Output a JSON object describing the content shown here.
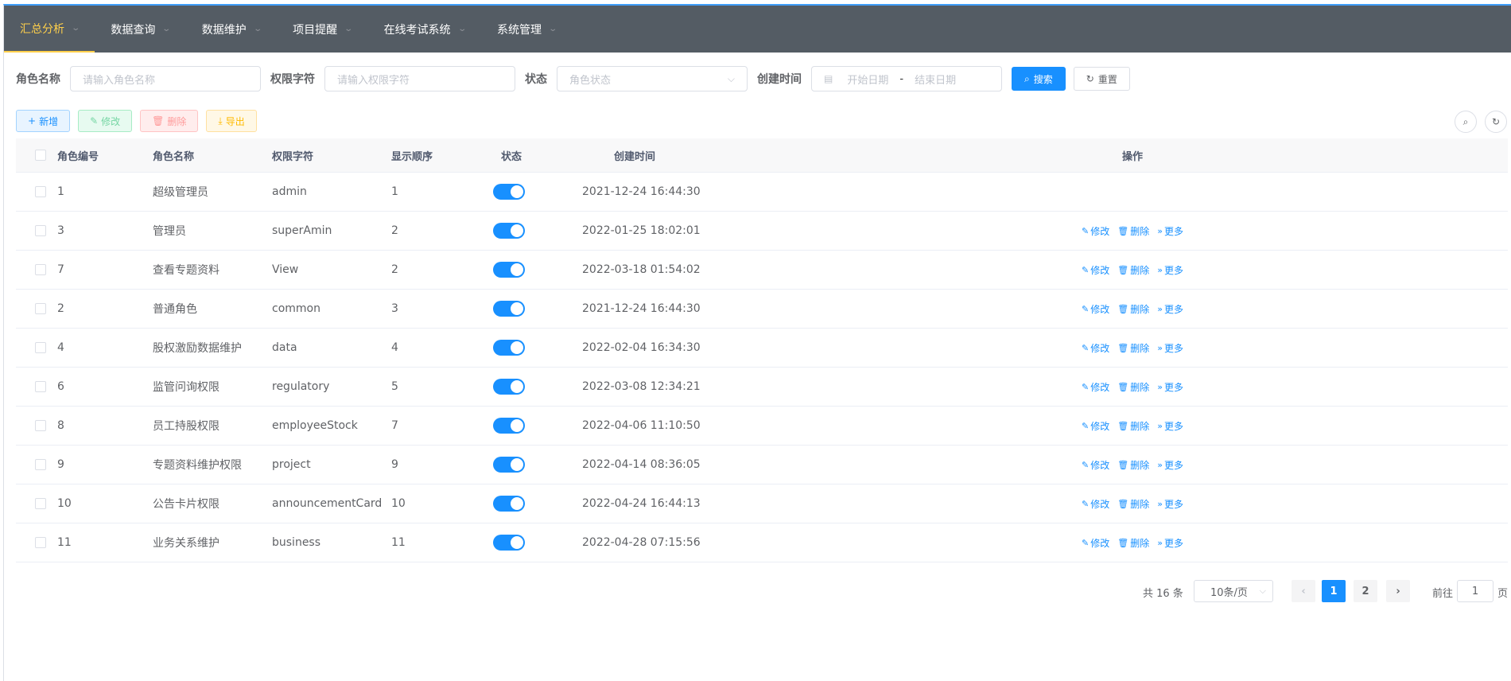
{
  "nav": {
    "items": [
      {
        "label": "汇总分析",
        "active": true
      },
      {
        "label": "数据查询"
      },
      {
        "label": "数据维护"
      },
      {
        "label": "项目提醒"
      },
      {
        "label": "在线考试系统"
      },
      {
        "label": "系统管理"
      }
    ]
  },
  "search": {
    "role_name_label": "角色名称",
    "role_name_placeholder": "请输入角色名称",
    "role_key_label": "权限字符",
    "role_key_placeholder": "请输入权限字符",
    "status_label": "状态",
    "status_placeholder": "角色状态",
    "created_label": "创建时间",
    "start_placeholder": "开始日期",
    "range_sep": "-",
    "end_placeholder": "结束日期",
    "search_button": "搜索",
    "reset_button": "重置"
  },
  "toolbar": {
    "add": "新增",
    "edit": "修改",
    "delete": "删除",
    "export": "导出"
  },
  "table": {
    "headers": {
      "id": "角色编号",
      "name": "角色名称",
      "key": "权限字符",
      "sort": "显示顺序",
      "status": "状态",
      "created": "创建时间",
      "ops": "操作"
    },
    "op_labels": {
      "edit": "修改",
      "delete": "删除",
      "more": "更多"
    },
    "rows": [
      {
        "id": "1",
        "name": "超级管理员",
        "key": "admin",
        "sort": "1",
        "status": true,
        "created": "2021-12-24 16:44:30",
        "ops": false
      },
      {
        "id": "3",
        "name": "管理员",
        "key": "superAmin",
        "sort": "2",
        "status": true,
        "created": "2022-01-25 18:02:01",
        "ops": true
      },
      {
        "id": "7",
        "name": "查看专题资料",
        "key": "View",
        "sort": "2",
        "status": true,
        "created": "2022-03-18 01:54:02",
        "ops": true
      },
      {
        "id": "2",
        "name": "普通角色",
        "key": "common",
        "sort": "3",
        "status": true,
        "created": "2021-12-24 16:44:30",
        "ops": true
      },
      {
        "id": "4",
        "name": "股权激励数据维护",
        "key": "data",
        "sort": "4",
        "status": true,
        "created": "2022-02-04 16:34:30",
        "ops": true
      },
      {
        "id": "6",
        "name": "监管问询权限",
        "key": "regulatory",
        "sort": "5",
        "status": true,
        "created": "2022-03-08 12:34:21",
        "ops": true
      },
      {
        "id": "8",
        "name": "员工持股权限",
        "key": "employeeStock",
        "sort": "7",
        "status": true,
        "created": "2022-04-06 11:10:50",
        "ops": true
      },
      {
        "id": "9",
        "name": "专题资料维护权限",
        "key": "project",
        "sort": "9",
        "status": true,
        "created": "2022-04-14 08:36:05",
        "ops": true
      },
      {
        "id": "10",
        "name": "公告卡片权限",
        "key": "announcementCard",
        "sort": "10",
        "status": true,
        "created": "2022-04-24 16:44:13",
        "ops": true
      },
      {
        "id": "11",
        "name": "业务关系维护",
        "key": "business",
        "sort": "11",
        "status": true,
        "created": "2022-04-28 07:15:56",
        "ops": true
      }
    ]
  },
  "pagination": {
    "total": "共 16 条",
    "page_size": "10条/页",
    "pages": [
      "1",
      "2"
    ],
    "current": "1",
    "goto_label": "前往",
    "goto_value": "1",
    "page_suffix": "页"
  },
  "colors": {
    "nav_bg": "#545c64",
    "nav_active": "#ffd04b",
    "primary": "#1890ff"
  }
}
